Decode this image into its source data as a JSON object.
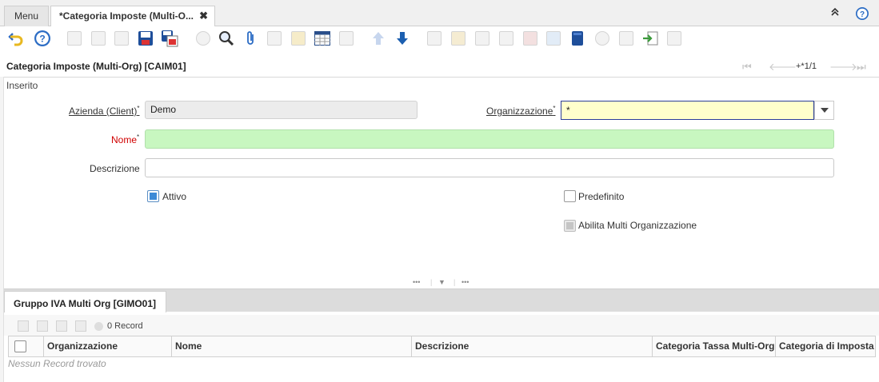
{
  "tabs": {
    "menu": "Menu",
    "active": "*Categoria Imposte (Multi-O...",
    "close": "✖"
  },
  "header": {
    "title": "Categoria Imposte (Multi-Org) [CAIM01]",
    "record_nav": "+*1/1",
    "status": "Inserito"
  },
  "form": {
    "azienda_label": "Azienda (Client)",
    "azienda_value": "Demo",
    "org_label": "Organizzazione",
    "org_value": "*",
    "nome_label": "Nome",
    "nome_value": "",
    "descr_label": "Descrizione",
    "descr_value": "",
    "attivo_label": "Attivo",
    "attivo_checked": true,
    "predef_label": "Predefinito",
    "predef_checked": false,
    "multiorg_label": "Abilita Multi Organizzazione",
    "multiorg_checked": true,
    "required_mark": "*"
  },
  "detail": {
    "tab_label": "Gruppo IVA Multi Org [GIMO01]",
    "record_count": "0 Record",
    "columns": [
      "Organizzazione",
      "Nome",
      "Descrizione",
      "Categoria Tassa Multi-Org",
      "Categoria di Imposta"
    ],
    "empty_text": "Nessun Record trovato"
  },
  "colors": {
    "mandatory": "#c8f7c0",
    "focus": "#ffffcc",
    "accent": "#1c5fb0",
    "required_label": "#d00000"
  },
  "icons": [
    "undo-icon",
    "help-icon",
    "new-icon",
    "copy-icon",
    "delete-icon",
    "save-icon",
    "save-new-icon",
    "refresh-icon",
    "find-icon",
    "attachment-icon",
    "chat-icon",
    "archive-icon",
    "grid-toggle-icon",
    "history-icon",
    "prev-record-icon",
    "next-record-icon",
    "report-icon",
    "print-icon",
    "zoom-icon",
    "workflow-icon",
    "chart-icon",
    "product-info-icon",
    "process-icon",
    "export-icon",
    "import-icon",
    "settings-icon"
  ]
}
